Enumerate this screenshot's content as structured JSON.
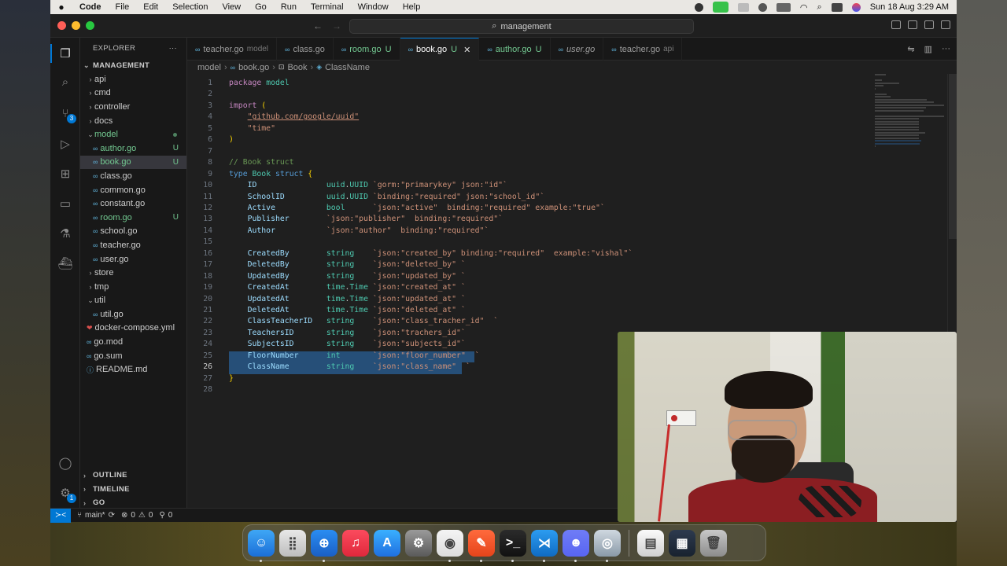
{
  "menubar": {
    "app": "Code",
    "items": [
      "File",
      "Edit",
      "Selection",
      "View",
      "Go",
      "Run",
      "Terminal",
      "Window",
      "Help"
    ],
    "datetime": "Sun 18 Aug  3:29 AM"
  },
  "titlebar": {
    "search": "management"
  },
  "activity": {
    "scm_badge": "3",
    "settings_badge": "1"
  },
  "sidebar": {
    "title": "EXPLORER",
    "more": "···",
    "root": "MANAGEMENT",
    "tree": [
      {
        "label": "api",
        "kind": "folder",
        "open": false,
        "depth": 1
      },
      {
        "label": "cmd",
        "kind": "folder",
        "open": false,
        "depth": 1
      },
      {
        "label": "controller",
        "kind": "folder",
        "open": false,
        "depth": 1
      },
      {
        "label": "docs",
        "kind": "folder",
        "open": false,
        "depth": 1
      },
      {
        "label": "model",
        "kind": "folder",
        "open": true,
        "depth": 1,
        "untracked": true
      },
      {
        "label": "author.go",
        "kind": "go",
        "depth": 2,
        "status": "U"
      },
      {
        "label": "book.go",
        "kind": "go",
        "depth": 2,
        "status": "U",
        "selected": true
      },
      {
        "label": "class.go",
        "kind": "go",
        "depth": 2
      },
      {
        "label": "common.go",
        "kind": "go",
        "depth": 2
      },
      {
        "label": "constant.go",
        "kind": "go",
        "depth": 2
      },
      {
        "label": "room.go",
        "kind": "go",
        "depth": 2,
        "status": "U"
      },
      {
        "label": "school.go",
        "kind": "go",
        "depth": 2
      },
      {
        "label": "teacher.go",
        "kind": "go",
        "depth": 2
      },
      {
        "label": "user.go",
        "kind": "go",
        "depth": 2
      },
      {
        "label": "store",
        "kind": "folder",
        "open": false,
        "depth": 1
      },
      {
        "label": "tmp",
        "kind": "folder",
        "open": false,
        "depth": 1
      },
      {
        "label": "util",
        "kind": "folder",
        "open": true,
        "depth": 1
      },
      {
        "label": "util.go",
        "kind": "go",
        "depth": 2
      },
      {
        "label": "docker-compose.yml",
        "kind": "yaml",
        "depth": 1
      },
      {
        "label": "go.mod",
        "kind": "go",
        "depth": 1
      },
      {
        "label": "go.sum",
        "kind": "go",
        "depth": 1
      },
      {
        "label": "README.md",
        "kind": "info",
        "depth": 1
      }
    ],
    "bottom_sections": [
      "OUTLINE",
      "TIMELINE",
      "GO"
    ]
  },
  "tabs": [
    {
      "label": "teacher.go",
      "hint": "model"
    },
    {
      "label": "class.go"
    },
    {
      "label": "room.go",
      "status": "U",
      "untracked": true
    },
    {
      "label": "book.go",
      "status": "U",
      "active": true
    },
    {
      "label": "author.go",
      "status": "U",
      "untracked": true
    },
    {
      "label": "user.go",
      "italic": true
    },
    {
      "label": "teacher.go",
      "hint": "api"
    }
  ],
  "breadcrumb": [
    "model",
    "book.go",
    "Book",
    "ClassName"
  ],
  "code_lines": [
    "package model",
    "",
    "import (",
    "    \"github.com/google/uuid\"",
    "    \"time\"",
    ")",
    "",
    "// Book struct",
    "type Book struct {",
    "    ID               uuid.UUID `gorm:\"primarykey\" json:\"id\"`",
    "    SchoolID         uuid.UUID `binding:\"required\" json:\"school_id\"`",
    "    Active           bool      `json:\"active\"  binding:\"required\" example:\"true\"`",
    "    Publisher        `json:\"publisher\"  binding:\"required\"`",
    "    Author           `json:\"author\"  binding:\"required\"`",
    "",
    "    CreatedBy        string    `json:\"created_by\" binding:\"required\"  example:\"vishal\"`",
    "    DeletedBy        string    `json:\"deleted_by\" `",
    "    UpdatedBy        string    `json:\"updated_by\" `",
    "    CreatedAt        time.Time `json:\"created_at\" `",
    "    UpdatedAt        time.Time `json:\"updated_at\" `",
    "    DeletedAt        time.Time `json:\"deleted_at\" `",
    "    ClassTeacherID   string    `json:\"class_tracher_id\"  `",
    "    TeachersID       string    `json:\"trachers_id\"`",
    "    SubjectsID       string    `json:\"subjects_id\"`",
    "    FloorNumber      int       `json:\"floor_number\"  `",
    "    ClassName        string    `json:\"class_name\"  `",
    "}",
    ""
  ],
  "current_line": 26,
  "statusbar": {
    "branch": "main*",
    "errors": "0",
    "warnings": "0",
    "ports": "0"
  },
  "dock": [
    "Finder",
    "Launchpad",
    "Safari",
    "Music",
    "App Store",
    "System Settings",
    "Chrome",
    "Draw",
    "Terminal",
    "VS Code",
    "Discord",
    "Preview",
    "Documents",
    "Screens",
    "Trash"
  ],
  "colors": {
    "accent": "#0078d4",
    "untracked": "#73c991",
    "selection": "#264f78"
  }
}
